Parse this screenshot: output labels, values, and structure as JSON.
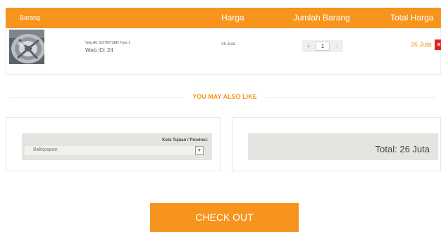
{
  "table": {
    "headers": {
      "barang": "Barang",
      "harga": "Harga",
      "jumlah": "Jumlah Barang",
      "total": "Total Harga"
    }
  },
  "cart": {
    "item": {
      "image_icon": "wheel-rim-photo",
      "name": "Velg AC SCHNITZER Type 1",
      "web_id": "Web ID: 24",
      "price": "26 Juta",
      "quantity": "1",
      "qty_minus": "+",
      "qty_plus": "-",
      "total": "26 Juta",
      "remove_icon": "close-icon",
      "remove_label": "×"
    }
  },
  "recommend": {
    "title": "YOU MAY ALSO LIKE"
  },
  "shipping": {
    "label": "Kota Tujuan / Provinsi:",
    "selected": "Balikpapan",
    "dropdown_icon": "chevron-down-icon",
    "dropdown_glyph": "▾"
  },
  "summary": {
    "total": "Total: 26 Juta"
  },
  "checkout": {
    "label": "CHECK OUT"
  },
  "colors": {
    "accent": "#f7941d",
    "remove": "#e2231a",
    "panel": "#e4e4e0"
  }
}
